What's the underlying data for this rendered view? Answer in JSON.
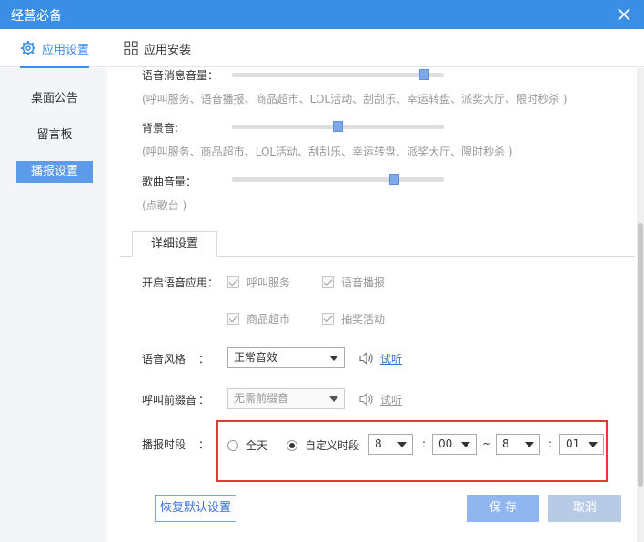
{
  "window": {
    "title": "经营必备"
  },
  "tabs": [
    {
      "label": "应用设置",
      "icon": "gear-icon",
      "active": true
    },
    {
      "label": "应用安装",
      "icon": "grid-icon",
      "active": false
    }
  ],
  "sidebar": {
    "items": [
      {
        "label": "桌面公告",
        "active": false
      },
      {
        "label": "留言板",
        "active": false
      },
      {
        "label": "播报设置",
        "active": true
      }
    ]
  },
  "volume": {
    "voice": {
      "label": "语音消息音量：",
      "level": 0.93,
      "hint": "(呼叫服务、语音播报、商品超市、LOL活动、刮刮乐、幸运转盘、派奖大厅、限时秒杀 )"
    },
    "background": {
      "label": "背景音:",
      "level": 0.5,
      "hint": "(呼叫服务、商品超市、LOL活动、刮刮乐、幸运转盘、派奖大厅、限时秒杀 )"
    },
    "song": {
      "label": "歌曲音量：",
      "level": 0.78,
      "hint": "(点歌台 )"
    }
  },
  "detail": {
    "tab_label": "详细设置",
    "voice_apps": {
      "label": "开启语音应用：",
      "options": [
        {
          "label": "呼叫服务",
          "checked": true
        },
        {
          "label": "语音播报",
          "checked": true
        },
        {
          "label": "商品超市",
          "checked": true
        },
        {
          "label": "抽奖活动",
          "checked": true
        }
      ]
    },
    "voice_style": {
      "label": "语音风格",
      "colon": "：",
      "value": "正常音效",
      "preview": "试听"
    },
    "call_prefix": {
      "label": "呼叫前缀音",
      "colon": "：",
      "value": "无需前缀音",
      "preview": "试听"
    },
    "broadcast_period": {
      "label": "播报时段",
      "colon": "：",
      "all_day": {
        "label": "全天",
        "selected": false
      },
      "custom": {
        "label": "自定义时段",
        "selected": true
      },
      "start_hour": "8",
      "start_minute": "00",
      "tilde": "~",
      "end_hour": "8",
      "end_minute": "01",
      "sep": ":"
    }
  },
  "buttons": {
    "reset": "恢复默认设置",
    "save": "保 存",
    "cancel": "取消"
  },
  "colors": {
    "accent": "#3a8ee6",
    "highlight_box": "#e53935"
  }
}
